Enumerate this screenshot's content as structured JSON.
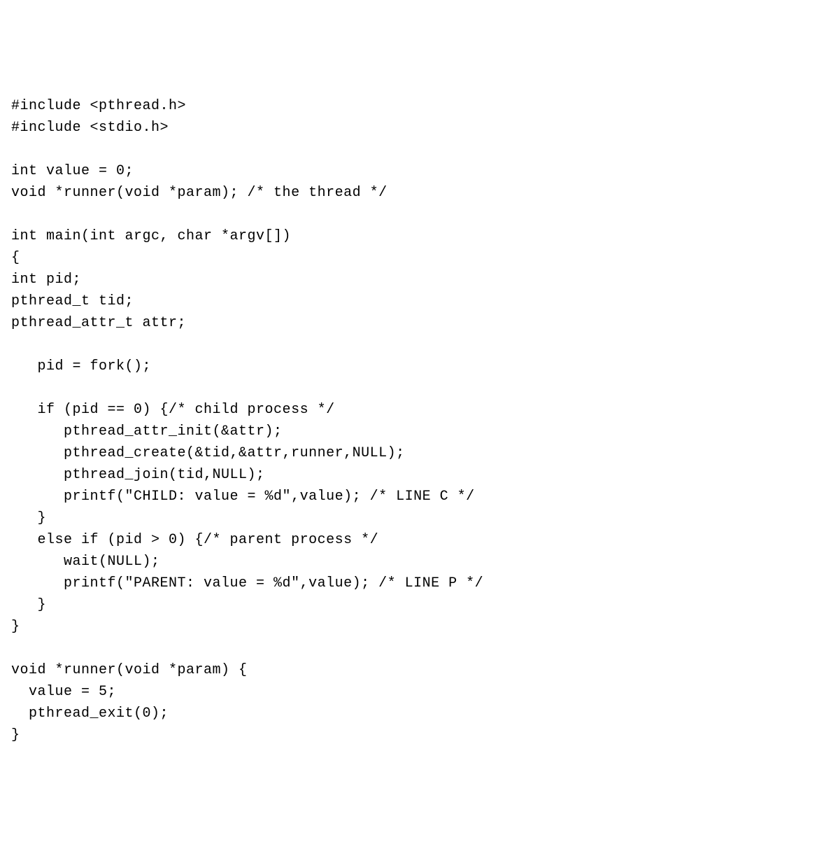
{
  "code": {
    "lines": [
      "#include <pthread.h>",
      "#include <stdio.h>",
      "",
      "int value = 0;",
      "void *runner(void *param); /* the thread */",
      "",
      "int main(int argc, char *argv[])",
      "{",
      "int pid;",
      "pthread_t tid;",
      "pthread_attr_t attr;",
      "",
      "   pid = fork();",
      "",
      "   if (pid == 0) {/* child process */",
      "      pthread_attr_init(&attr);",
      "      pthread_create(&tid,&attr,runner,NULL);",
      "      pthread_join(tid,NULL);",
      "      printf(\"CHILD: value = %d\",value); /* LINE C */",
      "   }",
      "   else if (pid > 0) {/* parent process */",
      "      wait(NULL);",
      "      printf(\"PARENT: value = %d\",value); /* LINE P */",
      "   }",
      "}",
      "",
      "void *runner(void *param) {",
      "  value = 5;",
      "  pthread_exit(0);",
      "}"
    ]
  }
}
